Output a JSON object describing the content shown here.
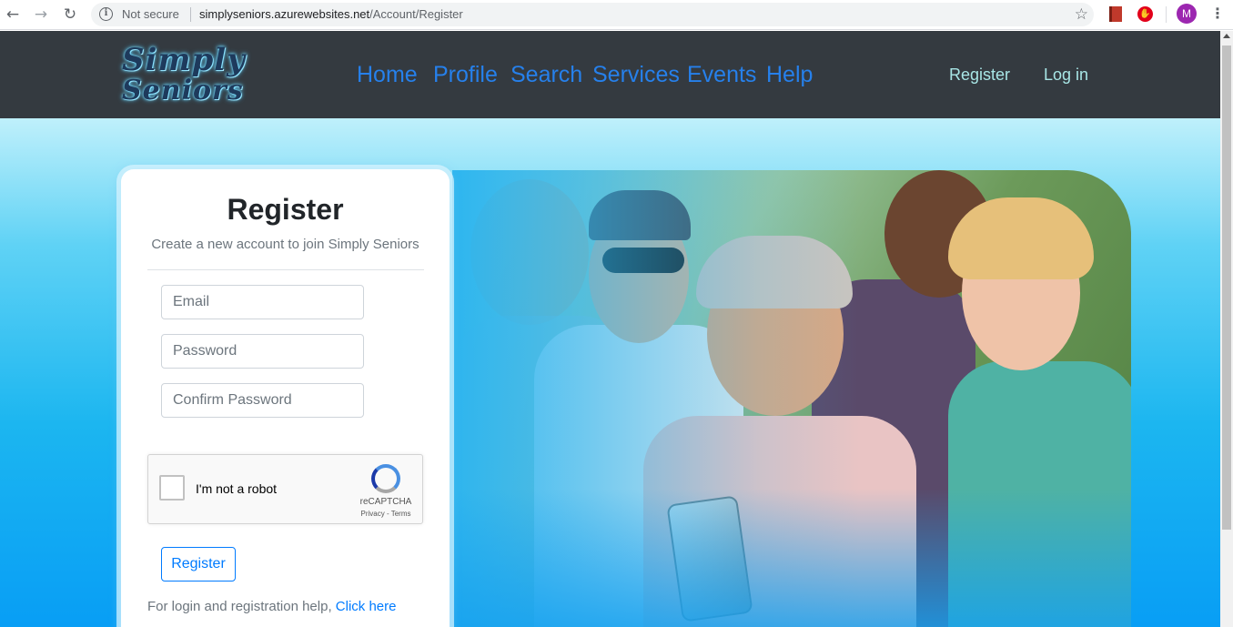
{
  "browser": {
    "not_secure": "Not secure",
    "url_host": "simplyseniors.azurewebsites.net",
    "url_path": "/Account/Register",
    "avatar_initial": "M",
    "icons": [
      "back-arrow-icon",
      "forward-arrow-icon",
      "reload-icon",
      "info-icon",
      "star-icon",
      "extension-icon",
      "adblock-icon",
      "kebab-menu-icon"
    ]
  },
  "nav": {
    "logo_line1": "Simply",
    "logo_line2": "Seniors",
    "menu": [
      "Home",
      "Profile",
      "Search",
      "Services",
      "Events",
      "Help"
    ],
    "auth": [
      "Register",
      "Log in"
    ]
  },
  "form": {
    "title": "Register",
    "subtitle": "Create a new account to join Simply Seniors",
    "email_placeholder": "Email",
    "password_placeholder": "Password",
    "confirm_placeholder": "Confirm Password",
    "captcha_label": "I'm not a robot",
    "captcha_brand": "reCAPTCHA",
    "captcha_terms": "Privacy - Terms",
    "submit_label": "Register",
    "help_text": "For login and registration help,",
    "help_link": "Click here"
  },
  "colors": {
    "navbar": "#343a40",
    "menu_link": "#2680eb",
    "auth_link": "#a8e6e6",
    "primary": "#007bff"
  }
}
